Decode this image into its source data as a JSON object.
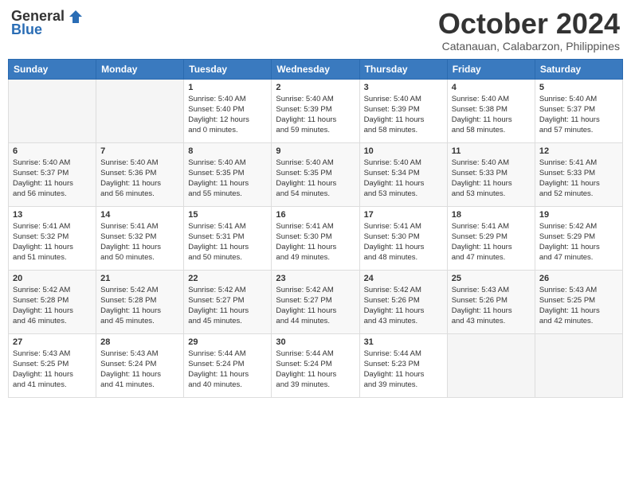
{
  "header": {
    "logo_general": "General",
    "logo_blue": "Blue",
    "month_title": "October 2024",
    "location": "Catanauan, Calabarzon, Philippines"
  },
  "days_of_week": [
    "Sunday",
    "Monday",
    "Tuesday",
    "Wednesday",
    "Thursday",
    "Friday",
    "Saturday"
  ],
  "weeks": [
    [
      {
        "day": "",
        "info": ""
      },
      {
        "day": "",
        "info": ""
      },
      {
        "day": "1",
        "info": "Sunrise: 5:40 AM\nSunset: 5:40 PM\nDaylight: 12 hours\nand 0 minutes."
      },
      {
        "day": "2",
        "info": "Sunrise: 5:40 AM\nSunset: 5:39 PM\nDaylight: 11 hours\nand 59 minutes."
      },
      {
        "day": "3",
        "info": "Sunrise: 5:40 AM\nSunset: 5:39 PM\nDaylight: 11 hours\nand 58 minutes."
      },
      {
        "day": "4",
        "info": "Sunrise: 5:40 AM\nSunset: 5:38 PM\nDaylight: 11 hours\nand 58 minutes."
      },
      {
        "day": "5",
        "info": "Sunrise: 5:40 AM\nSunset: 5:37 PM\nDaylight: 11 hours\nand 57 minutes."
      }
    ],
    [
      {
        "day": "6",
        "info": "Sunrise: 5:40 AM\nSunset: 5:37 PM\nDaylight: 11 hours\nand 56 minutes."
      },
      {
        "day": "7",
        "info": "Sunrise: 5:40 AM\nSunset: 5:36 PM\nDaylight: 11 hours\nand 56 minutes."
      },
      {
        "day": "8",
        "info": "Sunrise: 5:40 AM\nSunset: 5:35 PM\nDaylight: 11 hours\nand 55 minutes."
      },
      {
        "day": "9",
        "info": "Sunrise: 5:40 AM\nSunset: 5:35 PM\nDaylight: 11 hours\nand 54 minutes."
      },
      {
        "day": "10",
        "info": "Sunrise: 5:40 AM\nSunset: 5:34 PM\nDaylight: 11 hours\nand 53 minutes."
      },
      {
        "day": "11",
        "info": "Sunrise: 5:40 AM\nSunset: 5:33 PM\nDaylight: 11 hours\nand 53 minutes."
      },
      {
        "day": "12",
        "info": "Sunrise: 5:41 AM\nSunset: 5:33 PM\nDaylight: 11 hours\nand 52 minutes."
      }
    ],
    [
      {
        "day": "13",
        "info": "Sunrise: 5:41 AM\nSunset: 5:32 PM\nDaylight: 11 hours\nand 51 minutes."
      },
      {
        "day": "14",
        "info": "Sunrise: 5:41 AM\nSunset: 5:32 PM\nDaylight: 11 hours\nand 50 minutes."
      },
      {
        "day": "15",
        "info": "Sunrise: 5:41 AM\nSunset: 5:31 PM\nDaylight: 11 hours\nand 50 minutes."
      },
      {
        "day": "16",
        "info": "Sunrise: 5:41 AM\nSunset: 5:30 PM\nDaylight: 11 hours\nand 49 minutes."
      },
      {
        "day": "17",
        "info": "Sunrise: 5:41 AM\nSunset: 5:30 PM\nDaylight: 11 hours\nand 48 minutes."
      },
      {
        "day": "18",
        "info": "Sunrise: 5:41 AM\nSunset: 5:29 PM\nDaylight: 11 hours\nand 47 minutes."
      },
      {
        "day": "19",
        "info": "Sunrise: 5:42 AM\nSunset: 5:29 PM\nDaylight: 11 hours\nand 47 minutes."
      }
    ],
    [
      {
        "day": "20",
        "info": "Sunrise: 5:42 AM\nSunset: 5:28 PM\nDaylight: 11 hours\nand 46 minutes."
      },
      {
        "day": "21",
        "info": "Sunrise: 5:42 AM\nSunset: 5:28 PM\nDaylight: 11 hours\nand 45 minutes."
      },
      {
        "day": "22",
        "info": "Sunrise: 5:42 AM\nSunset: 5:27 PM\nDaylight: 11 hours\nand 45 minutes."
      },
      {
        "day": "23",
        "info": "Sunrise: 5:42 AM\nSunset: 5:27 PM\nDaylight: 11 hours\nand 44 minutes."
      },
      {
        "day": "24",
        "info": "Sunrise: 5:42 AM\nSunset: 5:26 PM\nDaylight: 11 hours\nand 43 minutes."
      },
      {
        "day": "25",
        "info": "Sunrise: 5:43 AM\nSunset: 5:26 PM\nDaylight: 11 hours\nand 43 minutes."
      },
      {
        "day": "26",
        "info": "Sunrise: 5:43 AM\nSunset: 5:25 PM\nDaylight: 11 hours\nand 42 minutes."
      }
    ],
    [
      {
        "day": "27",
        "info": "Sunrise: 5:43 AM\nSunset: 5:25 PM\nDaylight: 11 hours\nand 41 minutes."
      },
      {
        "day": "28",
        "info": "Sunrise: 5:43 AM\nSunset: 5:24 PM\nDaylight: 11 hours\nand 41 minutes."
      },
      {
        "day": "29",
        "info": "Sunrise: 5:44 AM\nSunset: 5:24 PM\nDaylight: 11 hours\nand 40 minutes."
      },
      {
        "day": "30",
        "info": "Sunrise: 5:44 AM\nSunset: 5:24 PM\nDaylight: 11 hours\nand 39 minutes."
      },
      {
        "day": "31",
        "info": "Sunrise: 5:44 AM\nSunset: 5:23 PM\nDaylight: 11 hours\nand 39 minutes."
      },
      {
        "day": "",
        "info": ""
      },
      {
        "day": "",
        "info": ""
      }
    ]
  ]
}
